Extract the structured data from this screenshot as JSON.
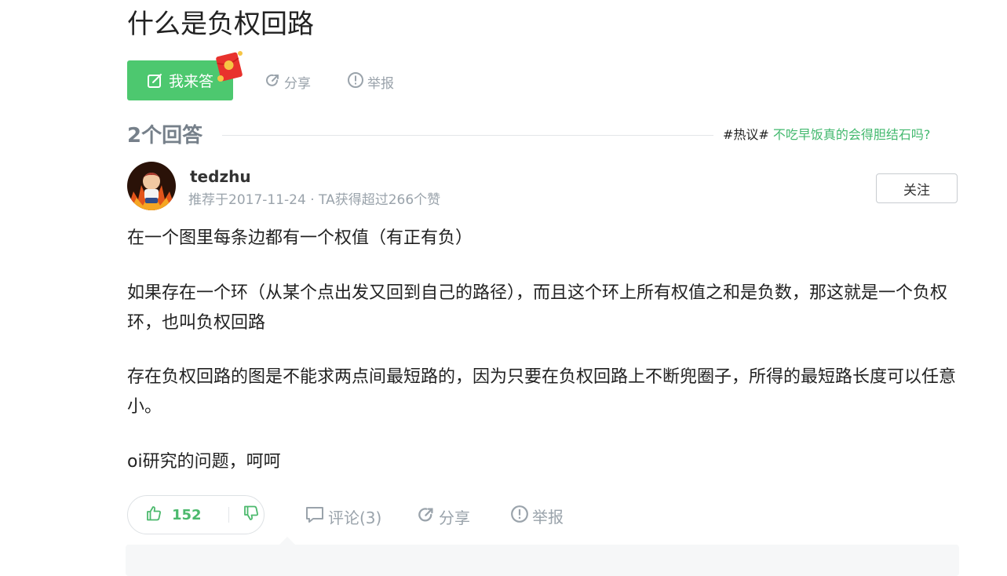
{
  "question": {
    "title": "什么是负权回路"
  },
  "actions": {
    "answer_label": "我来答",
    "share_label": "分享",
    "report_label": "举报"
  },
  "answers_header": {
    "count_label": "2个回答",
    "hot_tag": "#热议#",
    "hot_link": "不吃早饭真的会得胆结石吗?"
  },
  "answer": {
    "username": "tedzhu",
    "meta": "推荐于2017-11-24 · TA获得超过266个赞",
    "follow_label": "关注",
    "paragraphs": [
      "在一个图里每条边都有一个权值（有正有负）",
      "如果存在一个环（从某个点出发又回到自己的路径），而且这个环上所有权值之和是负数，那这就是一个负权环，也叫负权回路",
      "存在负权回路的图是不能求两点间最短路的，因为只要在负权回路上不断兜圈子，所得的最短路长度可以任意小。",
      "oi研究的问题，呵呵"
    ],
    "likes": "152",
    "comment_label": "评论(3)",
    "share_label": "分享",
    "report_label": "举报"
  },
  "colors": {
    "accent_green": "#4dc86f",
    "link_green": "#41b86d",
    "muted_gray": "#9aa3ab"
  },
  "icons": [
    "edit-icon",
    "red-packet-icon",
    "share-icon",
    "report-icon",
    "thumbs-up-icon",
    "thumbs-down-icon",
    "comment-icon"
  ]
}
